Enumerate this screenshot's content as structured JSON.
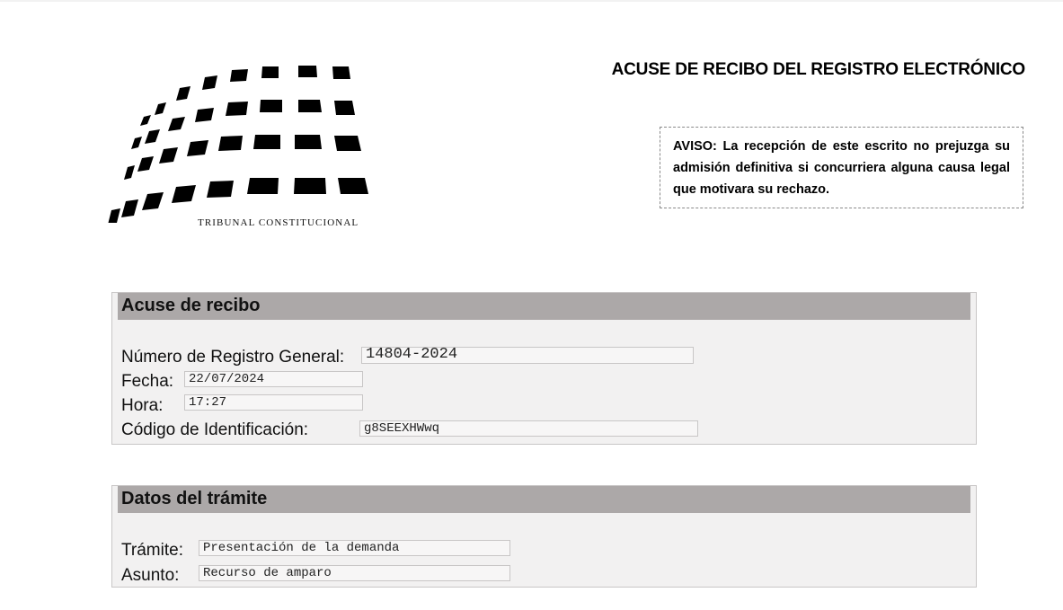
{
  "header": {
    "logo_caption": "TRIBUNAL CONSTITUCIONAL",
    "title": "ACUSE DE RECIBO DEL REGISTRO ELECTRÓNICO"
  },
  "notice": {
    "text": "AVISO: La  recepción de este escrito no prejuzga su admisión definitiva si concurriera alguna causa legal que motivara su rechazo."
  },
  "receipt": {
    "heading": "Acuse de recibo",
    "registro_label": "Número de Registro General:",
    "registro_value": "14804-2024",
    "fecha_label": "Fecha:",
    "fecha_value": "22/07/2024",
    "hora_label": "Hora:",
    "hora_value": "17:27",
    "codigo_label": "Código de Identificación:",
    "codigo_value": "g8SEEXHWwq"
  },
  "tramite": {
    "heading": "Datos del trámite",
    "tramite_label": "Trámite:",
    "tramite_value": "Presentación de la demanda",
    "asunto_label": "Asunto:",
    "asunto_value": "Recurso de amparo"
  },
  "colors": {
    "panel_header": "#aca8a8",
    "panel_bg": "#f2f1f1",
    "field_border": "#c8c6c6"
  }
}
